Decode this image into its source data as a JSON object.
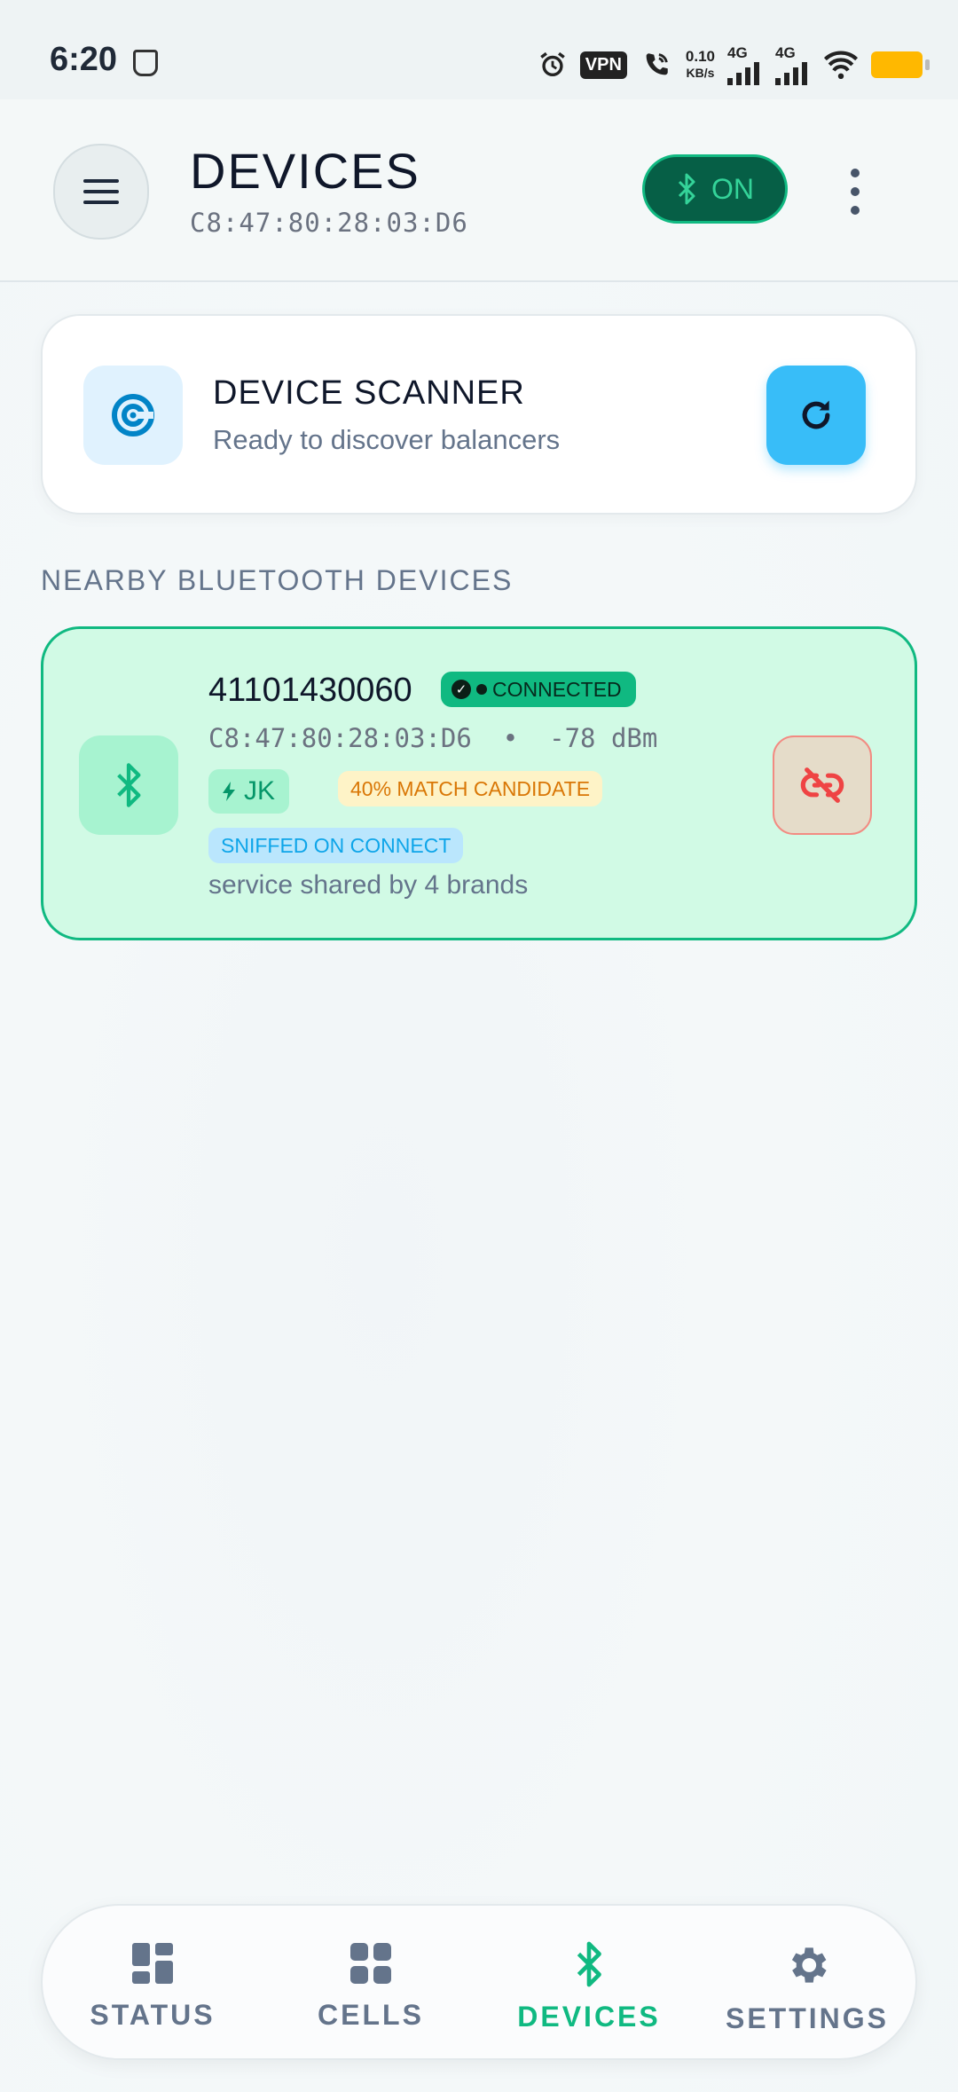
{
  "status_bar": {
    "time": "6:20",
    "vpn": "VPN",
    "speed_value": "0.10",
    "speed_unit": "KB/s",
    "network_1": "4G",
    "network_2": "4G",
    "icons": [
      "shield-icon",
      "alarm-icon",
      "wifi-call-icon",
      "signal-icon",
      "wifi-icon",
      "battery-icon"
    ]
  },
  "header": {
    "title": "DEVICES",
    "mac": "C8:47:80:28:03:D6",
    "bluetooth_toggle": "ON"
  },
  "scanner": {
    "title": "DEVICE SCANNER",
    "subtitle": "Ready to discover balancers"
  },
  "nearby": {
    "section_label": "NEARBY BLUETOOTH DEVICES",
    "devices": [
      {
        "name": "41101430060",
        "status": "CONNECTED",
        "mac_rssi": "C8:47:80:28:03:D6  •  -78 dBm",
        "brand": "JK",
        "match": "40% MATCH CANDIDATE",
        "sniff": "SNIFFED ON CONNECT",
        "note": "service shared by 4 brands"
      }
    ]
  },
  "nav": {
    "items": [
      {
        "label": "STATUS",
        "icon": "dashboard-icon"
      },
      {
        "label": "CELLS",
        "icon": "grid-icon"
      },
      {
        "label": "DEVICES",
        "icon": "bluetooth-icon",
        "active": true
      },
      {
        "label": "SETTINGS",
        "icon": "gear-icon"
      }
    ]
  },
  "colors": {
    "accent_green": "#10b981",
    "accent_blue": "#38bdf8",
    "warning": "#d97706",
    "danger": "#ef4444"
  }
}
